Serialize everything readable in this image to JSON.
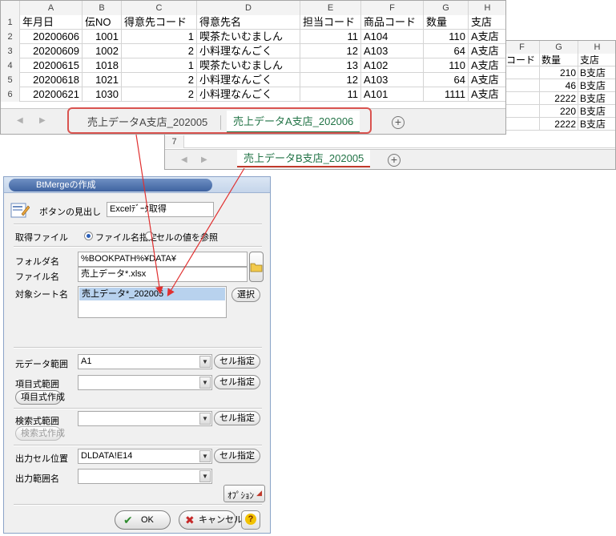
{
  "sheet_b": {
    "col_heads": [
      "F",
      "G",
      "H"
    ],
    "header_row": [
      "コード",
      "数量",
      "支店"
    ],
    "rows": [
      [
        "",
        "210",
        "B支店"
      ],
      [
        "",
        "46",
        "B支店"
      ],
      [
        "",
        "2222",
        "B支店"
      ],
      [
        "",
        "220",
        "B支店"
      ],
      [
        "",
        "2222",
        "B支店"
      ]
    ],
    "visible_row_number": "7",
    "tab_label": "売上データB支店_202005"
  },
  "sheet_a": {
    "col_heads": [
      "A",
      "B",
      "C",
      "D",
      "E",
      "F",
      "G",
      "H"
    ],
    "header": [
      "年月日",
      "伝NO",
      "得意先コード",
      "得意先名",
      "担当コード",
      "商品コード",
      "数量",
      "支店"
    ],
    "rows": [
      [
        "20200606",
        "1001",
        "1",
        "喫茶たいむましん",
        "11",
        "A104",
        "110",
        "A支店"
      ],
      [
        "20200609",
        "1002",
        "2",
        "小料理なんごく",
        "12",
        "A103",
        "64",
        "A支店"
      ],
      [
        "20200615",
        "1018",
        "1",
        "喫茶たいむましん",
        "13",
        "A102",
        "110",
        "A支店"
      ],
      [
        "20200618",
        "1021",
        "2",
        "小料理なんごく",
        "12",
        "A103",
        "64",
        "A支店"
      ],
      [
        "20200621",
        "1030",
        "2",
        "小料理なんごく",
        "11",
        "A101",
        "1111",
        "A支店"
      ]
    ],
    "row_numbers": [
      "1",
      "2",
      "3",
      "4",
      "5",
      "6"
    ],
    "tabs": [
      "売上データA支店_202005",
      "売上データA支店_202006"
    ],
    "active_tab": 1,
    "colors": {
      "active_tab": "#217346",
      "highlight": "#d9534f"
    }
  },
  "dialog": {
    "title": "BtMergeの作成",
    "caption_label": "ボタンの見出し",
    "caption_value": "Excelﾃﾞｰﾀ取得",
    "acquire_label": "取得ファイル",
    "radio_filename": "ファイル名指定",
    "radio_cell": "セルの値を参照",
    "folder_label": "フォルダ名",
    "folder_value": "%BOOKPATH%¥DATA¥",
    "file_label": "ファイル名",
    "file_value": "売上データ*.xlsx",
    "sheet_label": "対象シート名",
    "sheet_value": "売上データ*_202005",
    "select_button": "選択",
    "source_range_label": "元データ範囲",
    "source_range_value": "A1",
    "item_range_label": "項目式範囲",
    "item_range_value": "",
    "item_create_button": "項目式作成",
    "search_range_label": "検索式範囲",
    "search_range_value": "",
    "search_create_button": "検索式作成",
    "output_cell_label": "出力セル位置",
    "output_cell_value": "DLDATA!E14",
    "output_name_label": "出力範囲名",
    "output_name_value": "",
    "cell_spec_button": "セル指定",
    "option_button": "ｵﾌﾟｼｮﾝ",
    "ok_button": "OK",
    "cancel_button": "キャンセル",
    "help_button": "?"
  }
}
